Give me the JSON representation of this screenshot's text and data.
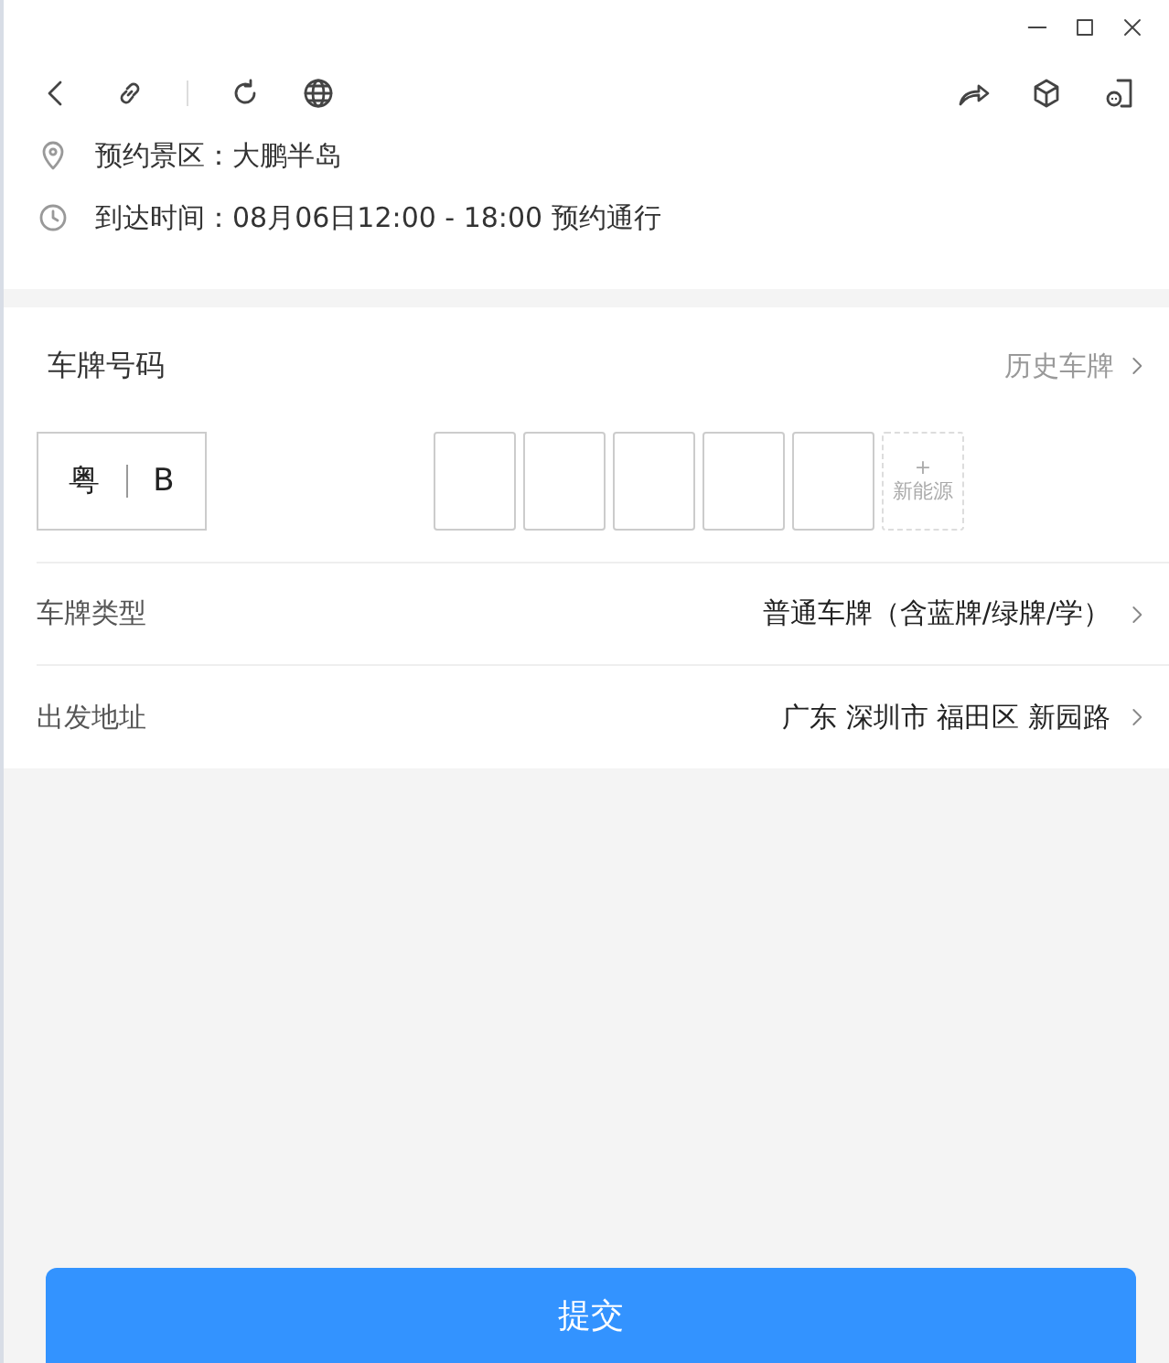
{
  "info": [
    {
      "kind": "location",
      "text": "预约景区：大鹏半岛"
    },
    {
      "kind": "time",
      "text": "到达时间：08月06日12:00 - 18:00 预约通行"
    }
  ],
  "plate": {
    "title": "车牌号码",
    "history": "历史车牌",
    "province": "粤",
    "city": "B",
    "slots": [
      {
        "kind": "empty"
      },
      {
        "kind": "empty"
      },
      {
        "kind": "empty"
      },
      {
        "kind": "empty"
      },
      {
        "kind": "empty"
      },
      {
        "kind": "new_energy",
        "plus": "+",
        "label": "新能源"
      }
    ]
  },
  "rows": [
    {
      "label": "车牌类型",
      "value": "普通车牌（含蓝牌/绿牌/学）"
    },
    {
      "label": "出发地址",
      "value": "广东 深圳市 福田区 新园路"
    }
  ],
  "submit": "提交"
}
